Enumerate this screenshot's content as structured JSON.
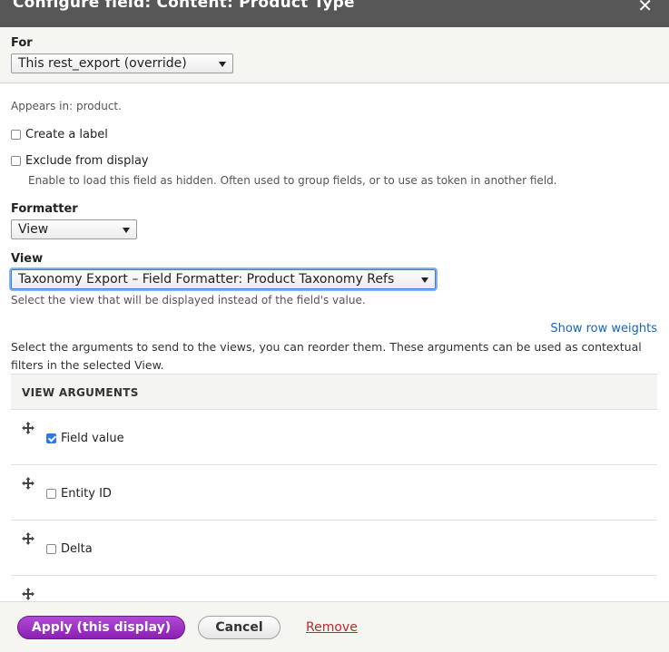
{
  "dialog": {
    "title": "Configure field: Content: Product Type",
    "close_glyph": "✕"
  },
  "for": {
    "label": "For",
    "selected": "This rest_export (override)"
  },
  "appears_in": "Appears in: product.",
  "create_label": {
    "label": "Create a label",
    "checked": false
  },
  "exclude": {
    "label": "Exclude from display",
    "checked": false,
    "description": "Enable to load this field as hidden. Often used to group fields, or to use as token in another field."
  },
  "formatter": {
    "label": "Formatter",
    "selected": "View"
  },
  "view": {
    "label": "View",
    "selected": "Taxonomy Export – Field Formatter: Product Taxonomy Refs",
    "description": "Select the view that will be displayed instead of the field's value."
  },
  "show_row_weights": "Show row weights",
  "arguments_help_1": "Select the arguments to send to the views, you can reorder them. These arguments can be used as contextual",
  "arguments_help_2": "filters in the selected View.",
  "table": {
    "header": "VIEW ARGUMENTS",
    "rows": [
      {
        "label": "Field value",
        "checked": true
      },
      {
        "label": "Entity ID",
        "checked": false
      },
      {
        "label": "Delta",
        "checked": false
      }
    ]
  },
  "footer": {
    "apply": "Apply (this display)",
    "cancel": "Cancel",
    "remove": "Remove"
  },
  "icons": [
    "close-icon",
    "dropdown-arrow-icon",
    "drag-handle-icon",
    "checkbox-icon"
  ],
  "colors": {
    "apply_button": "#8b1fb3",
    "link": "#1565c0",
    "remove_link": "#c0272d",
    "checkbox_checked": "#2a7ae2"
  }
}
